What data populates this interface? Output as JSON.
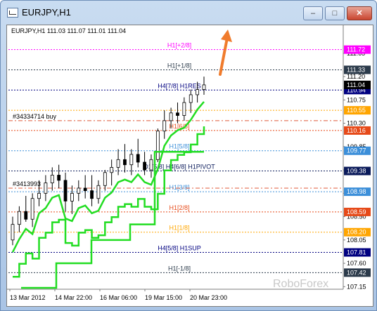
{
  "window": {
    "title": "EURJPY,H1",
    "min_glyph": "–",
    "max_glyph": "□",
    "close_glyph": "✕"
  },
  "chart": {
    "header_text": "EURJPY,H1  111.03 111.07 111.01 111.04",
    "watermark": "RoboForex",
    "orders": [
      "#34334714 buy",
      "#3413993"
    ]
  },
  "chart_data": {
    "type": "candlestick",
    "symbol": "EURJPY",
    "timeframe": "H1",
    "ohlc": {
      "open": 111.03,
      "high": 111.07,
      "low": 111.01,
      "close": 111.04
    },
    "ylim": [
      107.1,
      112.0
    ],
    "y_ticks": [
      "111.65",
      "111.20",
      "110.75",
      "110.30",
      "109.85",
      "109.40",
      "108.95",
      "108.50",
      "108.05",
      "107.60",
      "107.15"
    ],
    "x_ticks": [
      "13 Mar 2012",
      "14 Mar 22:00",
      "16 Mar 06:00",
      "19 Mar 15:00",
      "20 Mar 23:00"
    ],
    "current_price": "111.04",
    "bid_label": "110.94",
    "levels": [
      {
        "price": 111.72,
        "label": "H1[+2/8]",
        "tag": "111.72",
        "color": "#ff00ff",
        "style": "dot"
      },
      {
        "price": 111.33,
        "label": "H1[+1/8]",
        "tag": "111.33",
        "color": "#2b3a4a",
        "style": "dot"
      },
      {
        "price": 110.94,
        "label": "H4[7/8] H1RES",
        "tag": "110.94",
        "color": "#000080",
        "style": "dot"
      },
      {
        "price": 110.55,
        "label": "",
        "tag": "110.55",
        "color": "#ffa500",
        "style": "dot"
      },
      {
        "price": 110.16,
        "label": "H1[6/8]",
        "tag": "110.16",
        "color": "#e64a19",
        "style": "dot"
      },
      {
        "price": 109.77,
        "label": "H1[5/8]",
        "tag": "109.77",
        "color": "#3c8fd9",
        "style": "dot"
      },
      {
        "price": 109.38,
        "label": "D1[5/8] H4[6/8] H1PIVOT",
        "tag": "109.38",
        "color": "#0a1a5a",
        "style": "dot"
      },
      {
        "price": 108.98,
        "label": "H1[3/8]",
        "tag": "108.98",
        "color": "#3c8fd9",
        "style": "dot"
      },
      {
        "price": 108.59,
        "label": "H1[2/8]",
        "tag": "108.59",
        "color": "#e64a19",
        "style": "dot"
      },
      {
        "price": 108.2,
        "label": "H1[1/8]",
        "tag": "108.20",
        "color": "#ffa500",
        "style": "dot"
      },
      {
        "price": 107.81,
        "label": "H4[5/8] H1SUP",
        "tag": "107.81",
        "color": "#000080",
        "style": "dot"
      },
      {
        "price": 107.42,
        "label": "H1[-1/8]",
        "tag": "107.42",
        "color": "#2b3a4a",
        "style": "dot"
      }
    ],
    "order_lines": [
      {
        "price": 110.35,
        "color": "#e05a3a"
      },
      {
        "price": 109.05,
        "color": "#e05a3a"
      }
    ],
    "candles": [
      [
        108.05,
        108.5,
        107.95,
        108.35
      ],
      [
        108.35,
        108.7,
        108.2,
        108.6
      ],
      [
        108.6,
        108.9,
        108.4,
        108.45
      ],
      [
        108.45,
        108.95,
        108.3,
        108.85
      ],
      [
        108.85,
        109.2,
        108.7,
        108.95
      ],
      [
        108.95,
        109.3,
        108.8,
        109.15
      ],
      [
        109.15,
        109.45,
        109.0,
        109.3
      ],
      [
        109.3,
        109.5,
        109.05,
        109.2
      ],
      [
        109.2,
        109.35,
        108.6,
        108.8
      ],
      [
        108.8,
        109.1,
        108.55,
        108.95
      ],
      [
        108.95,
        109.2,
        108.8,
        109.05
      ],
      [
        109.05,
        109.3,
        108.85,
        109.0
      ],
      [
        109.0,
        109.3,
        108.7,
        108.85
      ],
      [
        108.85,
        109.2,
        108.75,
        109.1
      ],
      [
        109.1,
        109.4,
        109.0,
        109.35
      ],
      [
        109.35,
        109.6,
        109.1,
        109.45
      ],
      [
        109.45,
        109.8,
        109.3,
        109.6
      ],
      [
        109.6,
        109.9,
        109.35,
        109.5
      ],
      [
        109.5,
        109.8,
        109.3,
        109.7
      ],
      [
        109.7,
        110.0,
        109.45,
        109.55
      ],
      [
        109.55,
        109.75,
        109.3,
        109.4
      ],
      [
        109.4,
        109.7,
        109.25,
        109.6
      ],
      [
        109.6,
        110.2,
        109.55,
        110.15
      ],
      [
        110.15,
        110.55,
        110.0,
        110.35
      ],
      [
        110.35,
        110.6,
        110.2,
        110.5
      ],
      [
        110.5,
        110.7,
        110.3,
        110.45
      ],
      [
        110.45,
        110.8,
        110.35,
        110.7
      ],
      [
        110.7,
        110.95,
        110.5,
        110.85
      ],
      [
        110.85,
        111.1,
        110.7,
        110.95
      ],
      [
        110.95,
        111.2,
        110.85,
        111.04
      ]
    ]
  }
}
